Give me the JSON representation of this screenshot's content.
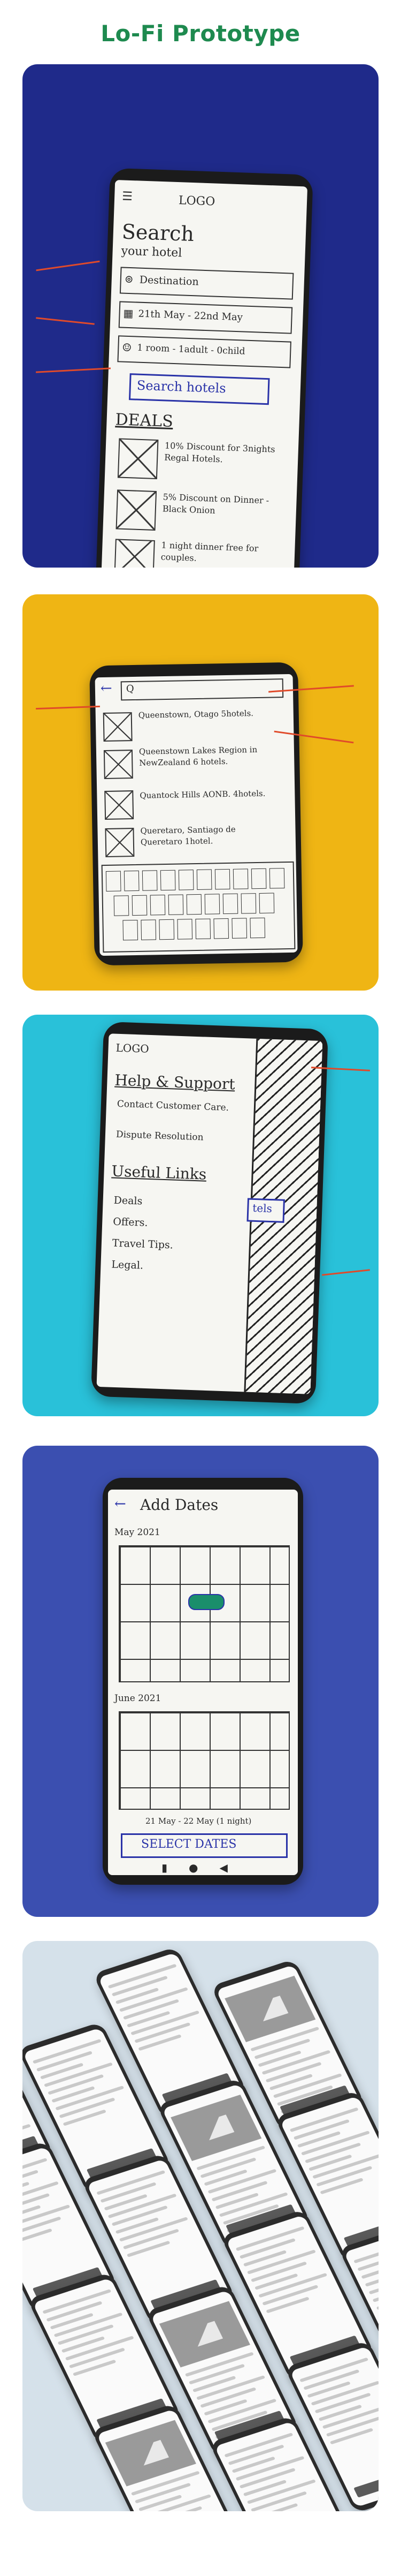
{
  "page": {
    "title": "Lo-Fi Prototype"
  },
  "colors": {
    "title": "#1e8a4f",
    "card1": "#1f2a8a",
    "card2": "#efb514",
    "card3": "#29c1d9",
    "card4": "#3b4fb0",
    "card5": "#d5e1ea",
    "highlight": "#2a33a8",
    "arrow": "#e04a2a"
  },
  "sketch1": {
    "logo": "LOGO",
    "search_heading": "Search",
    "search_sub": "your hotel",
    "field_destination": "Destination",
    "field_dates": "21th May - 22nd May",
    "field_guests": "1 room - 1adult - 0child",
    "search_button": "Search hotels",
    "deals_heading": "DEALS",
    "deals": [
      "10% Discount for 3nights Regal Hotels.",
      "5% Discount on Dinner - Black Onion",
      "1 night dinner free for couples."
    ]
  },
  "sketch2": {
    "query": "Q",
    "results": [
      "Queenstown, Otago 5hotels.",
      "Queenstown Lakes Region in NewZealand 6 hotels.",
      "Quantock Hills AONB. 4hotels.",
      "Queretaro, Santiago de Queretaro 1hotel."
    ]
  },
  "sketch3": {
    "logo": "LOGO",
    "help_heading": "Help & Support",
    "help_items": [
      "Contact Customer Care.",
      "Dispute Resolution"
    ],
    "links_heading": "Useful Links",
    "links": [
      "Deals",
      "Offers.",
      "Travel Tips.",
      "Legal."
    ],
    "side_label": "tels"
  },
  "sketch4": {
    "title": "Add Dates",
    "month1": "May 2021",
    "month2": "June 2021",
    "range": "21 May - 22 May (1 night)",
    "button": "SELECT DATES"
  }
}
